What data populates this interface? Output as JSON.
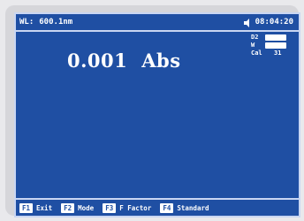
{
  "header": {
    "wl_label": "WL:",
    "wavelength": "600.1nm",
    "speaker_icon": "speaker-icon",
    "time": "08:04:20"
  },
  "main": {
    "value": "0.001",
    "unit": "Abs"
  },
  "indicators": {
    "items": [
      {
        "label": "D2",
        "state": "on"
      },
      {
        "label": "W",
        "state": "on"
      }
    ],
    "cal_label": "Cal",
    "cal_value": "31"
  },
  "softkeys": [
    {
      "key": "F1",
      "label": "Exit"
    },
    {
      "key": "F2",
      "label": "Mode"
    },
    {
      "key": "F3",
      "label": "F Factor"
    },
    {
      "key": "F4",
      "label": "Standard"
    }
  ],
  "colors": {
    "screen_bg": "#1f4fa3",
    "text": "#ffffff"
  }
}
